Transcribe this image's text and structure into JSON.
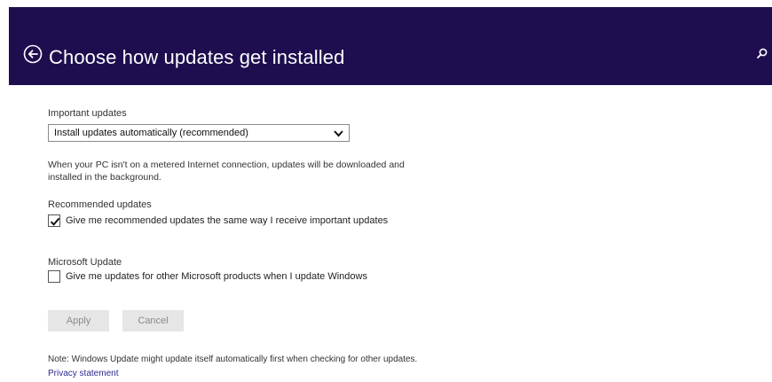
{
  "header": {
    "title": "Choose how updates get installed",
    "background_color": "#1e0e4f",
    "back_icon": "back-arrow-circle-icon",
    "search_icon": "search-icon"
  },
  "important_updates": {
    "label": "Important updates",
    "selected": "Install updates automatically (recommended)",
    "description": "When your PC isn't on a metered Internet connection, updates will be downloaded and installed in the background."
  },
  "recommended_updates": {
    "label": "Recommended updates",
    "checkbox_label": "Give me recommended updates the same way I receive important updates",
    "checked": true
  },
  "microsoft_update": {
    "label": "Microsoft Update",
    "checkbox_label": "Give me updates for other Microsoft products when I update Windows",
    "checked": false
  },
  "buttons": {
    "apply": "Apply",
    "cancel": "Cancel"
  },
  "footer": {
    "note": "Note: Windows Update might update itself automatically first when checking for other updates.",
    "privacy_link": "Privacy statement",
    "link_color": "#2d2a8f"
  }
}
